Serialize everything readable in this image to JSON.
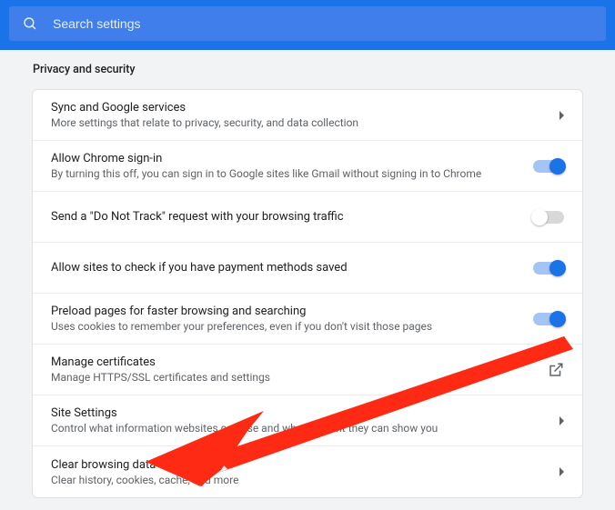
{
  "search": {
    "placeholder": "Search settings"
  },
  "section_title": "Privacy and security",
  "rows": [
    {
      "title": "Sync and Google services",
      "subtitle": "More settings that relate to privacy, security, and data collection"
    },
    {
      "title": "Allow Chrome sign-in",
      "subtitle": "By turning this off, you can sign in to Google sites like Gmail without signing in to Chrome",
      "toggle": true
    },
    {
      "title": "Send a \"Do Not Track\" request with your browsing traffic",
      "toggle": false
    },
    {
      "title": "Allow sites to check if you have payment methods saved",
      "toggle": true
    },
    {
      "title": "Preload pages for faster browsing and searching",
      "subtitle": "Uses cookies to remember your preferences, even if you don't visit those pages",
      "toggle": true
    },
    {
      "title": "Manage certificates",
      "subtitle": "Manage HTTPS/SSL certificates and settings"
    },
    {
      "title": "Site Settings",
      "subtitle": "Control what information websites can use and what content they can show you"
    },
    {
      "title": "Clear browsing data",
      "subtitle": "Clear history, cookies, cache, and more"
    }
  ],
  "annotation": {
    "arrow_color": "#ff2a13"
  }
}
